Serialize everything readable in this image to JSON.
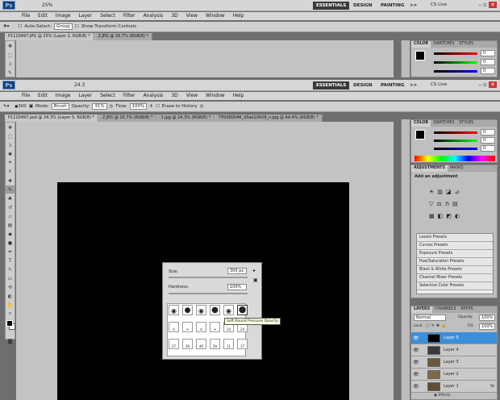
{
  "app": {
    "logo": "Ps",
    "zoom_top": "25%",
    "zoom_mid": "24.3",
    "cs_live": "CS Live"
  },
  "workspaces": [
    "ESSENTIALS",
    "DESIGN",
    "PAINTING",
    ">>"
  ],
  "menu": [
    "File",
    "Edit",
    "Image",
    "Layer",
    "Select",
    "Filter",
    "Analysis",
    "3D",
    "View",
    "Window",
    "Help"
  ],
  "top_options": {
    "auto_select": "Auto-Select:",
    "group": "Group",
    "transform": "Show Transform Controls"
  },
  "top_tabs": [
    "P1110497.JPG @ 25% (Layer 2, RGB/8) *",
    "2.JPG @ 16.7% (RGB/8) *"
  ],
  "mid_options": {
    "mode_label": "Mode:",
    "mode": "Brush",
    "opacity_label": "Opacity:",
    "opacity": "31%",
    "flow_label": "Flow:",
    "flow": "100%",
    "erase_history": "Erase to History",
    "brush_size": "300"
  },
  "mid_tabs": [
    "P1110497.psd @ 24.3% (Layer 5, RGB/8) *",
    "2.JPG @ 16.7% (RGB/8) *",
    "1.jpg @ 24.3% (RGB/8) *",
    "TP0d00046_d3ae10429_n.jpg @ 44.4% (RGB/8) *"
  ],
  "color_panel": {
    "tabs": [
      "COLOR",
      "SWATCHES",
      "STYLES"
    ],
    "r": "0",
    "g": "0",
    "b": "0"
  },
  "adjust_panel": {
    "tabs": [
      "ADJUSTMENTS",
      "MASKS"
    ],
    "title": "Add an adjustment",
    "presets": [
      "Levels Presets",
      "Curves Presets",
      "Exposure Presets",
      "Hue/Saturation Presets",
      "Black & White Presets",
      "Channel Mixer Presets",
      "Selective Color Presets"
    ]
  },
  "layers_panel": {
    "tabs": [
      "LAYERS",
      "CHANNELS",
      "PATHS"
    ],
    "blend": "Normal",
    "opacity_label": "Opacity:",
    "opacity": "100%",
    "lock": "Lock:",
    "fill_label": "Fill:",
    "fill": "100%",
    "layers": [
      "Layer 5",
      "Layer 4",
      "Layer 3",
      "Layer 2",
      "Layer 1"
    ],
    "effects": "Effects"
  },
  "brush_popup": {
    "size_label": "Size:",
    "size": "300 px",
    "hardness_label": "Hardness:",
    "hardness": "100%",
    "tooltip": "Soft Round Pressure Opacity",
    "numbers": [
      "27",
      "39",
      "46",
      "59",
      "11",
      "17"
    ],
    "row2": [
      "14",
      "24"
    ]
  }
}
